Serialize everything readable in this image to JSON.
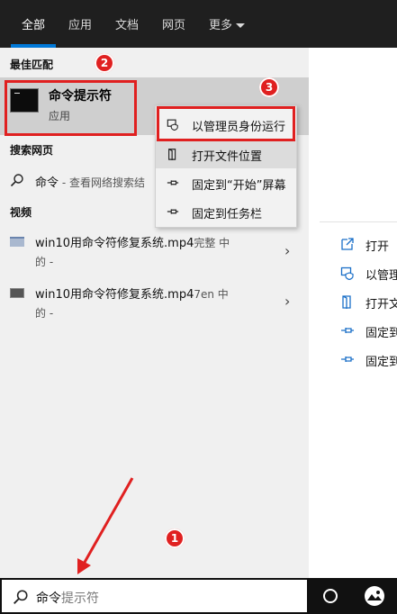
{
  "tabs": [
    {
      "label": "全部",
      "active": true
    },
    {
      "label": "应用"
    },
    {
      "label": "文档"
    },
    {
      "label": "网页"
    },
    {
      "label": "更多"
    }
  ],
  "sections": {
    "best_match": "最佳匹配",
    "web_search": "搜索网页",
    "videos": "视频"
  },
  "best_match": {
    "title": "命令提示符",
    "subtitle": "应用",
    "icon": "cmd-icon"
  },
  "web_result": {
    "query": "命令",
    "suffix": " - 查看网络搜索结"
  },
  "videos": [
    {
      "title": "win10用命令符修复系统.mp4",
      "tag": "完整 中",
      "second_line": "的 -"
    },
    {
      "title": "win10用命令符修复系统.mp4",
      "tag": "7en 中",
      "second_line": "的 -"
    }
  ],
  "context_menu": [
    {
      "label": "以管理员身份运行",
      "icon": "shield-icon"
    },
    {
      "label": "打开文件位置",
      "icon": "folder-icon"
    },
    {
      "label": "固定到“开始”屏幕",
      "icon": "pin-icon"
    },
    {
      "label": "固定到任务栏",
      "icon": "pin-icon"
    }
  ],
  "right_actions": [
    {
      "label": "打开",
      "icon": "open-icon"
    },
    {
      "label": "以管理",
      "icon": "shield-icon"
    },
    {
      "label": "打开文",
      "icon": "folder-icon"
    },
    {
      "label": "固定到",
      "icon": "pin-icon"
    },
    {
      "label": "固定到",
      "icon": "pin-icon"
    }
  ],
  "search": {
    "typed": "命令",
    "placeholder_rest": "提示符"
  },
  "annotations": [
    "1",
    "2",
    "3"
  ],
  "colors": {
    "accent": "#0078d7",
    "annotation": "#e02020",
    "topbar": "#1f1f1f",
    "panel": "#f0f0f0"
  }
}
